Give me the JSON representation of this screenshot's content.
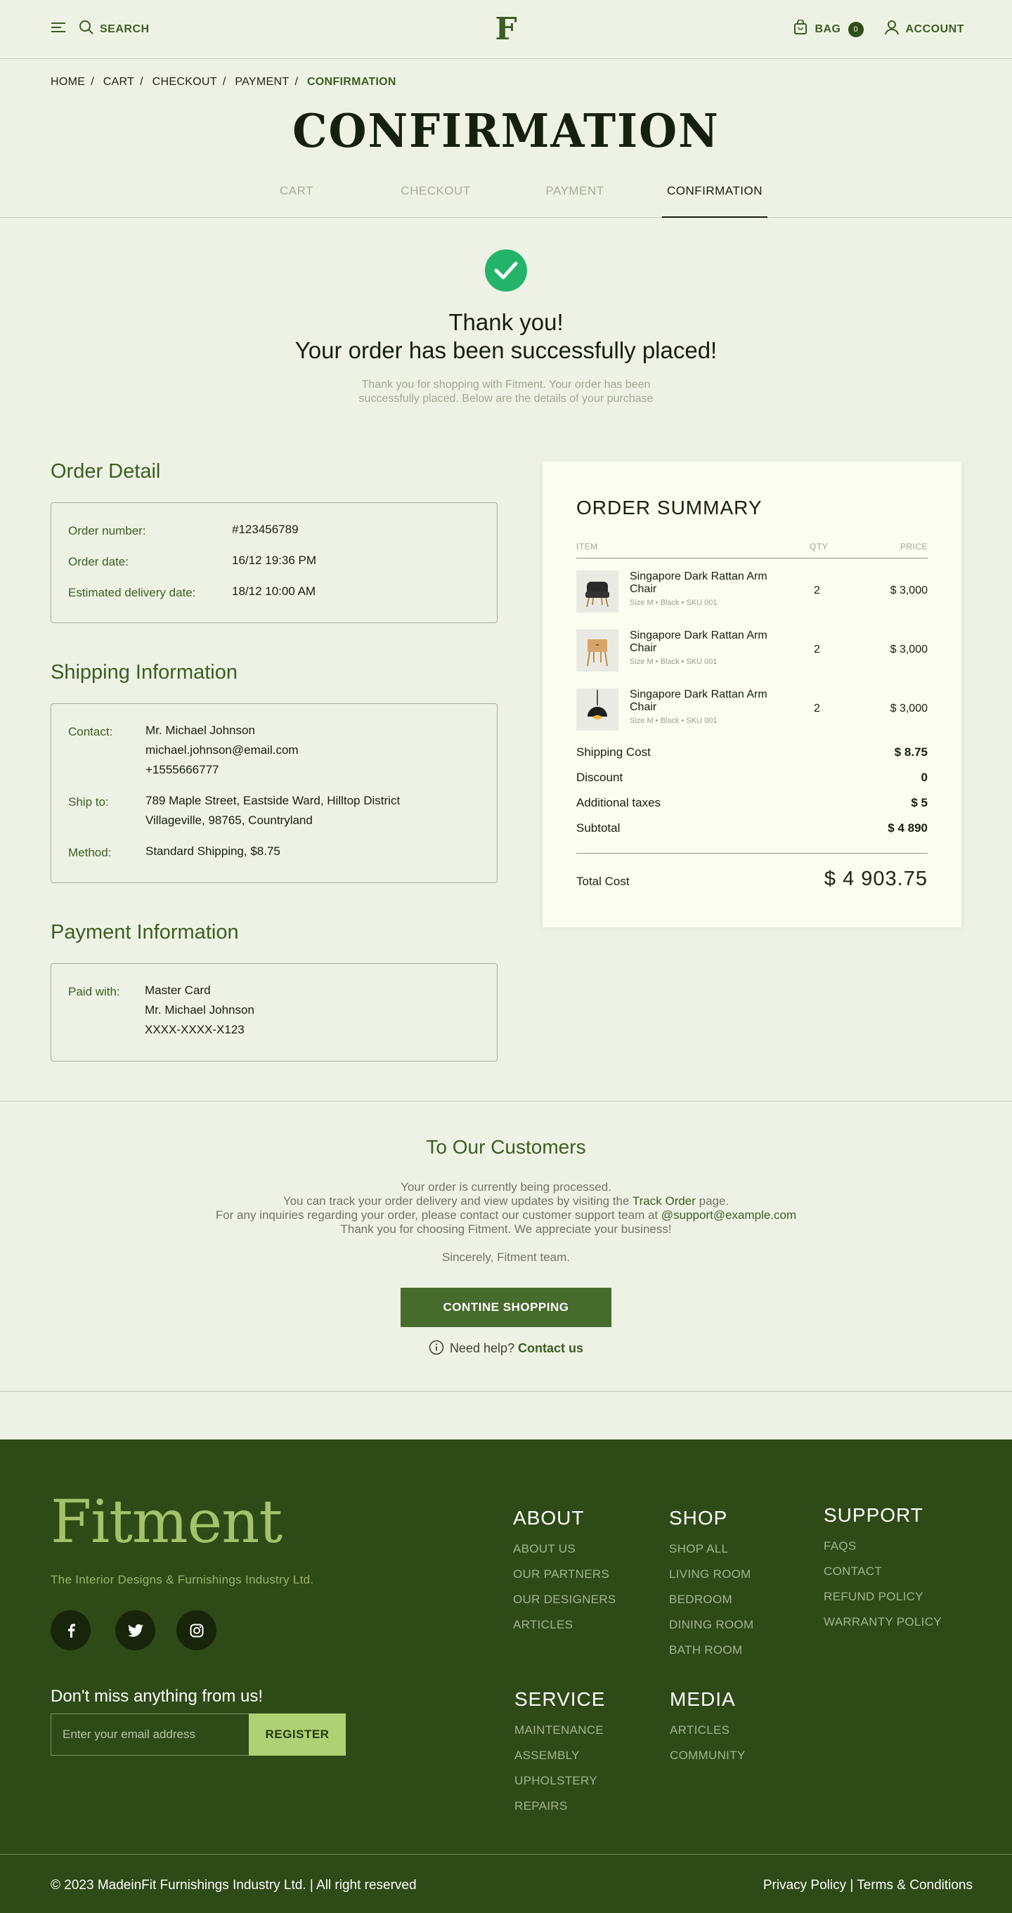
{
  "header": {
    "search_label": "SEARCH",
    "logo_letter": "F",
    "bag_label": "BAG",
    "bag_count": "0",
    "account_label": "ACCOUNT"
  },
  "breadcrumb": [
    "HOME",
    "CART",
    "CHECKOUT",
    "PAYMENT",
    "CONFIRMATION"
  ],
  "page_title": "CONFIRMATION",
  "steps": [
    "CART",
    "CHECKOUT",
    "PAYMENT",
    "CONFIRMATION"
  ],
  "active_step": "CONFIRMATION",
  "thanks": {
    "line1": "Thank you!",
    "line2": "Your order has been successfully placed!",
    "sub": "Thank you for shopping with Fitment. Your order has been successfully placed. Below are the details of your purchase"
  },
  "order_detail": {
    "title": "Order Detail",
    "number_label": "Order number:",
    "number": "#123456789",
    "date_label": "Order date:",
    "date": "16/12 19:36 PM",
    "delivery_label": "Estimated delivery date:",
    "delivery": "18/12 10:00 AM"
  },
  "shipping": {
    "title": "Shipping Information",
    "contact_label": "Contact:",
    "contact_name": "Mr. Michael Johnson",
    "contact_email": "michael.johnson@email.com",
    "contact_phone": "+1555666777",
    "ship_label": "Ship to:",
    "ship_line1": "789 Maple Street, Eastside Ward, Hilltop District",
    "ship_line2": "Villageville, 98765, Countryland",
    "method_label": "Method:",
    "method": "Standard Shipping, $8.75"
  },
  "payment": {
    "title": "Payment Information",
    "paid_label": "Paid with:",
    "card": "Master Card",
    "holder": "Mr. Michael Johnson",
    "number": "XXXX-XXXX-X123"
  },
  "summary": {
    "title": "ORDER SUMMARY",
    "col_item": "ITEM",
    "col_qty": "QTY",
    "col_price": "PRICE",
    "items": [
      {
        "name": "Singapore Dark Rattan Arm Chair",
        "size": "Size M",
        "color": "Black",
        "sku": "SKU 001",
        "qty": "2",
        "price": "$ 3,000",
        "icon": "armchair-icon"
      },
      {
        "name": "Singapore Dark Rattan Arm Chair",
        "size": "Size M",
        "color": "Black",
        "sku": "SKU 001",
        "qty": "2",
        "price": "$ 3,000",
        "icon": "side-table-icon"
      },
      {
        "name": "Singapore Dark Rattan Arm Chair",
        "size": "Size M",
        "color": "Black",
        "sku": "SKU 001",
        "qty": "2",
        "price": "$ 3,000",
        "icon": "pendant-lamp-icon"
      }
    ],
    "shipping_label": "Shipping Cost",
    "shipping_value": "$ 8.75",
    "discount_label": "Discount",
    "discount_value": "0",
    "taxes_label": "Additional taxes",
    "taxes_value": "$ 5",
    "subtotal_label": "Subtotal",
    "subtotal_value": "$ 4 890",
    "total_label": "Total Cost",
    "total_value": "$ 4 903.75"
  },
  "customers": {
    "title": "To Our Customers",
    "line1": "Your order is currently being processed.",
    "line2_pre": "You can track your order delivery and view updates by visiting the ",
    "line2_link": "Track Order",
    "line2_post": " page.",
    "line3_pre": "For any inquiries regarding your order, please contact our customer support team at ",
    "line3_link": "@support@example.com",
    "line4": "Thank you for choosing Fitment. We appreciate your business!",
    "sincerely": "Sincerely, Fitment team.",
    "button": "CONTINE SHOPPING",
    "help_text": "Need help?",
    "help_link": "Contact us"
  },
  "footer": {
    "logo": "Fitment",
    "tagline": "The Interior Designs & Furnishings Industry Ltd.",
    "newsletter_title": "Don't miss anything from us!",
    "email_placeholder": "Enter your email address",
    "register": "REGISTER",
    "about": {
      "title": "ABOUT",
      "links": [
        "ABOUT US",
        "OUR PARTNERS",
        "OUR DESIGNERS",
        "ARTICLES"
      ]
    },
    "shop": {
      "title": "SHOP",
      "links": [
        "SHOP ALL",
        "LIVING ROOM",
        "BEDROOM",
        "DINING ROOM",
        "BATH ROOM"
      ]
    },
    "support": {
      "title": "SUPPORT",
      "links": [
        "FAQS",
        "CONTACT",
        "REFUND POLICY",
        "WARRANTY POLICY"
      ]
    },
    "service": {
      "title": "SERVICE",
      "links": [
        "MAINTENANCE",
        "ASSEMBLY",
        "UPHOLSTERY",
        "REPAIRS"
      ]
    },
    "media": {
      "title": "MEDIA",
      "links": [
        "ARTICLES",
        "COMMUNITY"
      ]
    },
    "copyright": "© 2023 MadeinFit Furnishings Industry Ltd.  | All right reserved",
    "privacy": "Privacy Policy",
    "legal_sep": " | ",
    "terms": "Terms & Conditions"
  },
  "colors": {
    "accent": "#3b5e22",
    "footer_bg": "#2e4b17",
    "success": "#23b46a",
    "page_bg": "#eef2e4"
  }
}
